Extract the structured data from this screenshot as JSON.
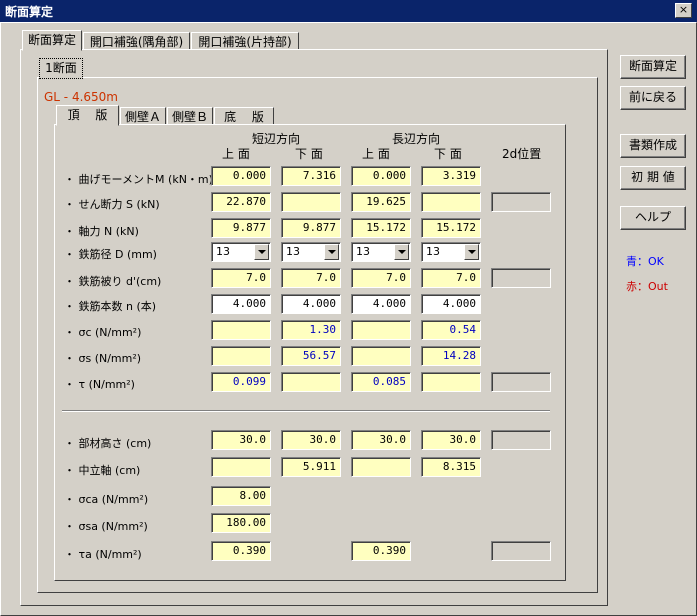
{
  "window": {
    "title": "断面算定",
    "close": "×"
  },
  "tabs": [
    "断面算定",
    "開口補強(隅角部)",
    "開口補強(片持部)"
  ],
  "subtab": "1断面",
  "gl": "GL - 4.650m",
  "inner_tabs": [
    "頂　 版",
    "側壁Ａ",
    "側壁Ｂ",
    "底　 版"
  ],
  "headers": {
    "short_dir": "短辺方向",
    "long_dir": "長辺方向",
    "top1": "上 面",
    "bottom1": "下 面",
    "top2": "上 面",
    "bottom2": "下 面",
    "pos2d": "2d位置"
  },
  "rows": [
    {
      "label": "・ 曲げモーメントM (kN・m)",
      "v": [
        "0.000",
        "7.316",
        "0.000",
        "3.319"
      ]
    },
    {
      "label": "・ せん断力 S (kN)",
      "v": [
        "22.870",
        "",
        "19.625",
        ""
      ]
    },
    {
      "label": "・ 軸力 N (kN)",
      "v": [
        "9.877",
        "9.877",
        "15.172",
        "15.172"
      ]
    },
    {
      "label": "・ 鉄筋径 D (mm)",
      "v": [
        "13",
        "13",
        "13",
        "13"
      ]
    },
    {
      "label": "・ 鉄筋被り d'(cm)",
      "v": [
        "7.0",
        "7.0",
        "7.0",
        "7.0"
      ]
    },
    {
      "label": "・ 鉄筋本数 n (本)",
      "v": [
        "4.000",
        "4.000",
        "4.000",
        "4.000"
      ]
    },
    {
      "label": "・ σc (N/mm²)",
      "v": [
        "",
        "1.30",
        "",
        "0.54"
      ]
    },
    {
      "label": "・ σs (N/mm²)",
      "v": [
        "",
        "56.57",
        "",
        "14.28"
      ]
    },
    {
      "label": "・ τ (N/mm²)",
      "v": [
        "0.099",
        "",
        "0.085",
        ""
      ]
    }
  ],
  "rows2": [
    {
      "label": "・ 部材高さ (cm)",
      "v": [
        "30.0",
        "30.0",
        "30.0",
        "30.0"
      ]
    },
    {
      "label": "・ 中立軸 (cm)",
      "v": [
        "",
        "5.911",
        "",
        "8.315"
      ]
    },
    {
      "label": "・ σca (N/mm²)",
      "v": [
        "8.00"
      ]
    },
    {
      "label": "・ σsa (N/mm²)",
      "v": [
        "180.00"
      ]
    },
    {
      "label": "・ τa (N/mm²)",
      "v": [
        "0.390",
        "0.390"
      ]
    }
  ],
  "buttons": {
    "calc": "断面算定",
    "back": "前に戻る",
    "docs": "書類作成",
    "init": "初 期 値",
    "help": "ヘルプ"
  },
  "legend": {
    "ok": "青：OK",
    "out": "赤：Out",
    "ok_color": "#0000ff",
    "out_color": "#cc0000"
  },
  "colors": {
    "title_bar": "#0a246a",
    "input_bg": "#ffffc0",
    "gl_color": "#cc3300"
  }
}
